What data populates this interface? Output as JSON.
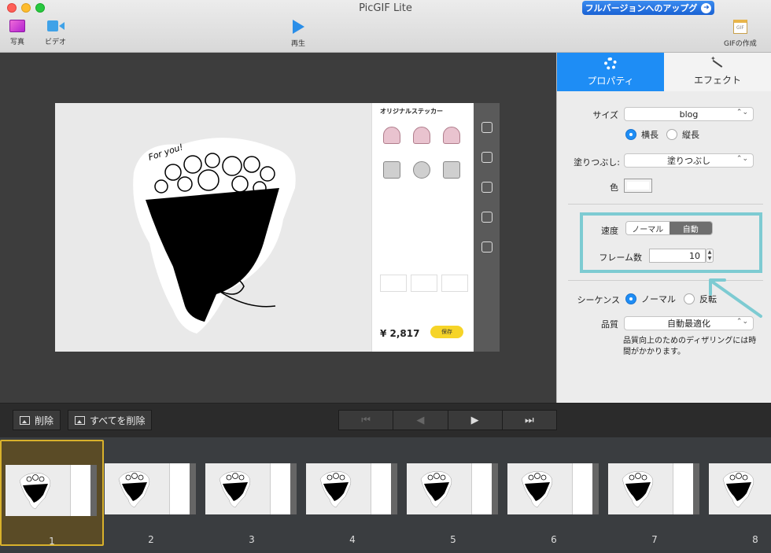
{
  "window": {
    "title": "PicGIF Lite",
    "upgrade_label": "フルバージョンへのアップグ"
  },
  "toolbar": {
    "photo_label": "写真",
    "video_label": "ビデオ",
    "play_label": "再生",
    "gif_label": "GIFの作成"
  },
  "preview": {
    "store_title": "オリジナルステッカー",
    "price": "¥ 2,817",
    "buy_label": "保存"
  },
  "panel": {
    "tabs": [
      {
        "label": "プロパティ",
        "active": true
      },
      {
        "label": "エフェクト",
        "active": false
      }
    ],
    "size_label": "サイズ",
    "size_value": "blog",
    "orientation": {
      "landscape": "横長",
      "portrait": "縦長",
      "selected": "横長"
    },
    "fill_label": "塗りつぶし:",
    "fill_value": "塗りつぶし",
    "color_label": "色",
    "speed_label": "速度",
    "speed_options": [
      "ノーマル",
      "自動"
    ],
    "speed_selected": "自動",
    "frames_label": "フレーム数",
    "frames_value": "10",
    "sequence_label": "シーケンス",
    "sequence_options": {
      "normal": "ノーマル",
      "reverse": "反転",
      "selected": "ノーマル"
    },
    "quality_label": "品質",
    "quality_value": "自動最適化",
    "quality_note": "品質向上のためのディザリングには時間がかかります。",
    "highlight_color": "#7dcbd2",
    "accent_color": "#1e8df5"
  },
  "bottom": {
    "delete_label": "削除",
    "delete_all_label": "すべてを削除",
    "nav_icons": [
      "first-frame-icon",
      "prev-frame-icon",
      "next-frame-icon",
      "last-frame-icon"
    ]
  },
  "frames": [
    "1",
    "2",
    "3",
    "4",
    "5",
    "6",
    "7",
    "8"
  ],
  "selected_frame": "1"
}
